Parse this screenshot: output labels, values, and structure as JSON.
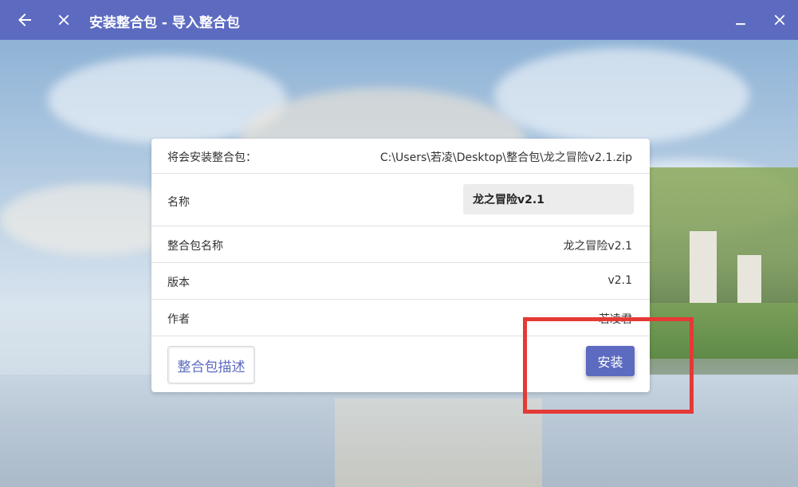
{
  "window": {
    "title": "安装整合包 - 导入整合包"
  },
  "icons": {
    "back": "arrow-left-icon",
    "close_page": "close-icon",
    "minimize": "minimize-icon",
    "close_window": "close-icon"
  },
  "colors": {
    "accent": "#5c6bc0",
    "highlight": "#e53935"
  },
  "modpack": {
    "file_label": "将会安装整合包：",
    "file_path": "C:\\Users\\若凌\\Desktop\\整合包\\龙之冒险v2.1.zip",
    "name_label": "名称",
    "name_value": "龙之冒险v2.1",
    "pack_name_label": "整合包名称",
    "pack_name_value": "龙之冒险v2.1",
    "version_label": "版本",
    "version_value": "v2.1",
    "author_label": "作者",
    "author_value": "若凌君"
  },
  "actions": {
    "description_label": "整合包描述",
    "install_label": "安装"
  }
}
